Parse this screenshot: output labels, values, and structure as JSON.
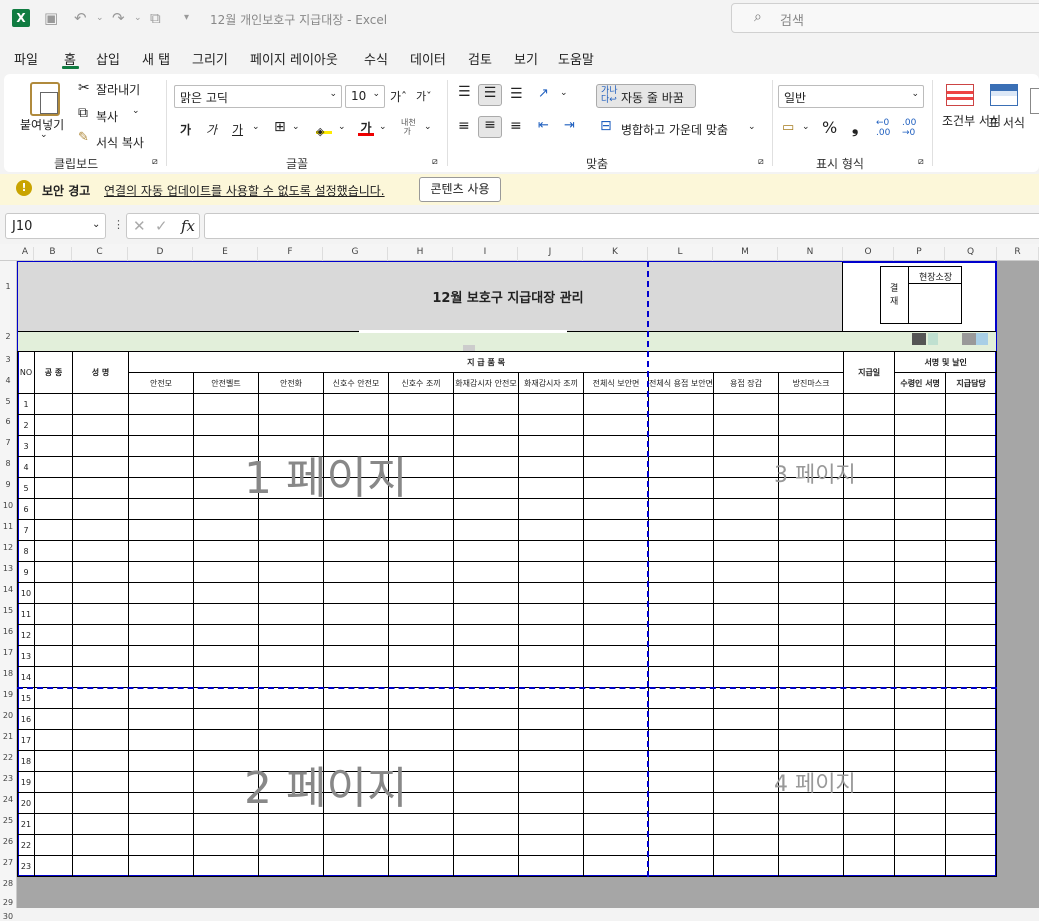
{
  "window": {
    "title": "12월 개인보호구 지급대장 - Excel",
    "search_placeholder": "검색"
  },
  "menu": [
    "파일",
    "홈",
    "삽입",
    "새 탭",
    "그리기",
    "페이지 레이아웃",
    "수식",
    "데이터",
    "검토",
    "보기",
    "도움말"
  ],
  "ribbon": {
    "paste": "붙여넣기",
    "cut": "잘라내기",
    "copy": "복사",
    "format_painter": "서식 복사",
    "g_clipboard": "클립보드",
    "font_name": "맑은 고딕",
    "font_size": "10",
    "g_font": "글꼴",
    "wrap_text": "자동 줄 바꿈",
    "merge_center": "병합하고 가운데 맞춤",
    "g_align": "맞춤",
    "number_format": "일반",
    "g_number": "표시 형식",
    "cond_format": "조건부 서식",
    "table_format": "표 서식"
  },
  "security": {
    "label": "보안 경고",
    "message": "연결의 자동 업데이트를 사용할 수 없도록 설정했습니다.",
    "button": "콘텐츠 사용"
  },
  "formula": {
    "name_box": "J10",
    "fx": "fx",
    "value": ""
  },
  "columns": [
    "A",
    "B",
    "C",
    "D",
    "E",
    "F",
    "G",
    "H",
    "I",
    "J",
    "K",
    "L",
    "M",
    "N",
    "O",
    "P",
    "Q",
    "R"
  ],
  "rows": [
    "1",
    "2",
    "3",
    "4",
    "5",
    "6",
    "7",
    "8",
    "9",
    "10",
    "11",
    "12",
    "13",
    "14",
    "15",
    "16",
    "17",
    "18",
    "19",
    "20",
    "21",
    "22",
    "23",
    "24",
    "25",
    "26",
    "27",
    "28",
    "29",
    "30"
  ],
  "sheet": {
    "title": "12월 보호구 지급대장 관리",
    "approval": {
      "label1": "결",
      "label2": "재",
      "head": "현장소장"
    },
    "headers": {
      "no": "NO",
      "kind": "공 종",
      "name": "성 명",
      "group": "지 급 품 목",
      "sign_group": "서명 및 날인",
      "date": "지급일",
      "receiver": "수령인 서명",
      "giver": "지급담당"
    },
    "items": [
      "안전모",
      "안전벨트",
      "안전화",
      "신호수 안전모",
      "신호수 조끼",
      "화재감시자 안전모",
      "화재감시자 조끼",
      "전체식 보안면",
      "전체식 용접 보안면",
      "용접 장갑",
      "방진마스크"
    ],
    "numbers": [
      "1",
      "2",
      "3",
      "4",
      "5",
      "6",
      "7",
      "8",
      "9",
      "10",
      "11",
      "12",
      "13",
      "14",
      "15",
      "16",
      "17",
      "18",
      "19",
      "20",
      "21",
      "22",
      "23"
    ],
    "page_labels": [
      "1 페이지",
      "2 페이지",
      "3 페이지",
      "4 페이지"
    ]
  }
}
